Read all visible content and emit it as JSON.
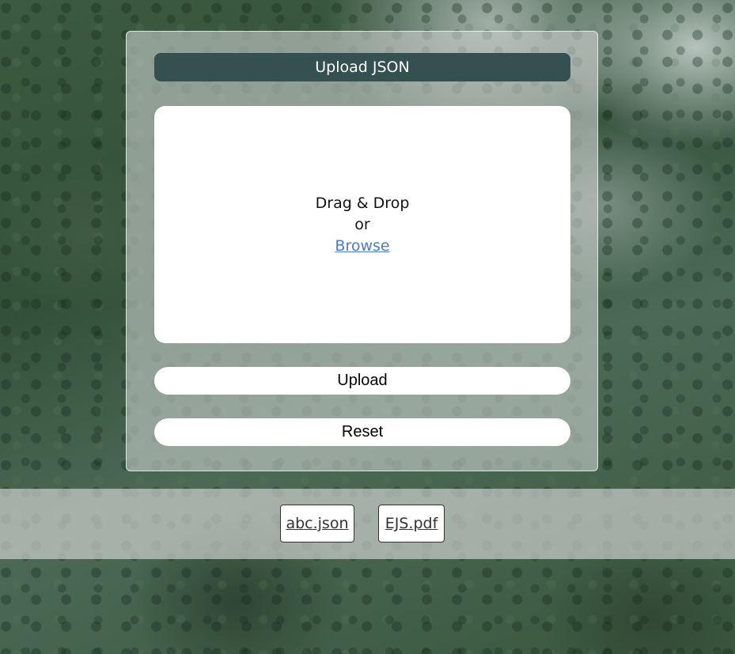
{
  "card": {
    "title": "Upload JSON"
  },
  "dropzone": {
    "line1": "Drag & Drop",
    "line2": "or",
    "browse_label": "Browse"
  },
  "buttons": {
    "upload_label": "Upload",
    "reset_label": "Reset"
  },
  "files": [
    {
      "name": "abc.json"
    },
    {
      "name": "EJS.pdf"
    }
  ],
  "colors": {
    "title_bar": "#345050",
    "browse_link": "#4a7ad2",
    "card_background": "rgba(200,205,204,0.62)"
  }
}
